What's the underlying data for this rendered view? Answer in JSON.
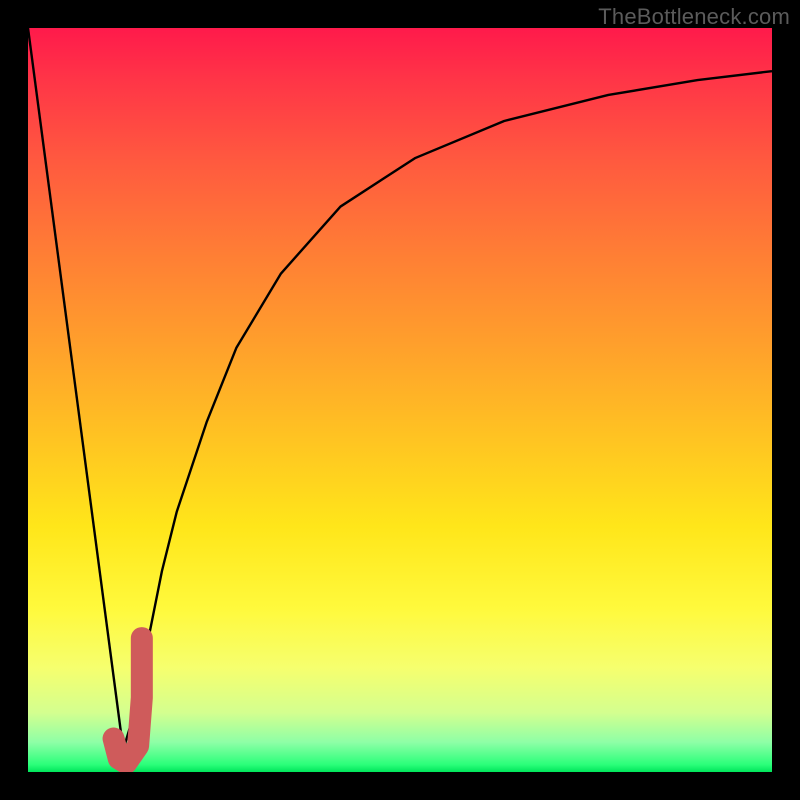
{
  "watermark": "TheBottleneck.com",
  "chart_data": {
    "type": "line",
    "title": "",
    "xlabel": "",
    "ylabel": "",
    "xlim": [
      0,
      100
    ],
    "ylim": [
      0,
      100
    ],
    "grid": false,
    "series": [
      {
        "name": "left-line",
        "stroke": "#000000",
        "weight": 2.4,
        "x": [
          0,
          12.8
        ],
        "values": [
          100,
          3
        ]
      },
      {
        "name": "right-curve",
        "stroke": "#000000",
        "weight": 2.4,
        "x": [
          12.8,
          14,
          16,
          18,
          20,
          24,
          28,
          34,
          42,
          52,
          64,
          78,
          90,
          100
        ],
        "values": [
          3,
          7,
          17,
          27,
          35,
          47,
          57,
          67,
          76,
          82.5,
          87.5,
          91,
          93,
          94.2
        ]
      },
      {
        "name": "j-marker",
        "stroke": "#cf5b5b",
        "weight": 22,
        "linecap": "round",
        "x": [
          11.5,
          12.2,
          13.2,
          14.8,
          15.3,
          15.3
        ],
        "values": [
          4.5,
          1.8,
          1.2,
          3.5,
          10,
          18
        ]
      }
    ],
    "background_gradient": {
      "direction": "top-to-bottom",
      "stops": [
        {
          "pos": 0.0,
          "color": "#ff1a4b"
        },
        {
          "pos": 0.3,
          "color": "#ff7d35"
        },
        {
          "pos": 0.67,
          "color": "#ffe61a"
        },
        {
          "pos": 0.92,
          "color": "#d4ff8f"
        },
        {
          "pos": 1.0,
          "color": "#00e55b"
        }
      ]
    }
  }
}
